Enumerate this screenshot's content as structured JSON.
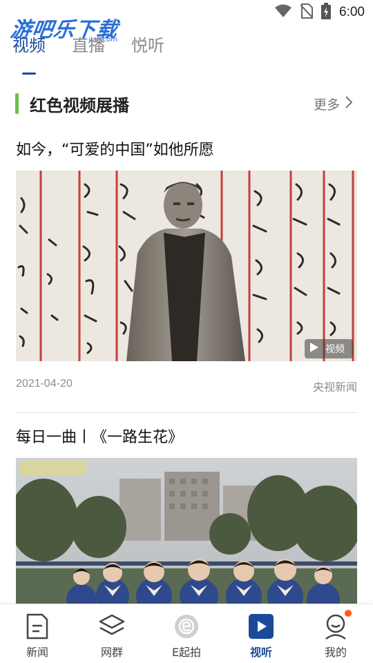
{
  "status_bar": {
    "time": "6:00"
  },
  "watermark": {
    "text": "游吧乐下载",
    "sub": "yalkcom"
  },
  "top_tabs": [
    {
      "label": "视频",
      "active": true
    },
    {
      "label": "直播",
      "active": false
    },
    {
      "label": "悦听",
      "active": false
    }
  ],
  "section": {
    "title": "红色视频展播",
    "more_label": "更多"
  },
  "articles": [
    {
      "title": "如今，“可爱的中国”如他所愿",
      "badge_label": "视频",
      "date": "2021-04-20",
      "source": "央视新闻"
    },
    {
      "title": "每日一曲丨《一路生花》"
    }
  ],
  "bottom_nav": [
    {
      "label": "新闻",
      "icon": "news-icon",
      "active": false
    },
    {
      "label": "网群",
      "icon": "layers-icon",
      "active": false
    },
    {
      "label": "E起拍",
      "icon": "e-camera-icon",
      "active": false
    },
    {
      "label": "视听",
      "icon": "play-video-icon",
      "active": true
    },
    {
      "label": "我的",
      "icon": "profile-icon",
      "active": false,
      "has_notification": true
    }
  ],
  "colors": {
    "accent_blue": "#1a4a9a",
    "accent_green": "#6cc04a",
    "notification": "#ff5a1f"
  }
}
